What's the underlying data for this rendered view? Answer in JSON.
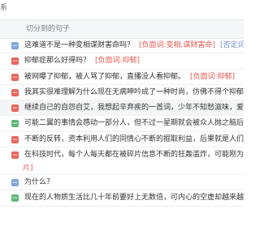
{
  "top_label": "系",
  "header": {
    "title": "切分到的句子"
  },
  "rows": [
    {
      "badge_color": "#7aa6e0",
      "badge_text": "—",
      "text": "这难道不是一种变相谋财害命吗？",
      "tags": [
        "[负面词:变相,谋财害命]",
        "[否定词"
      ]
    },
    {
      "badge_color": "#e8665c",
      "badge_text": "—",
      "text": "抑郁症那么好得吗？",
      "tags": [
        "[负面词:抑郁]"
      ]
    },
    {
      "badge_color": "#e8665c",
      "badge_text": "—",
      "text": "被网曝了抑郁，被人骂了抑郁，直播没人看抑郁。",
      "tags": [
        "[负面词:抑郁]"
      ]
    },
    {
      "badge_color": "#e8665c",
      "badge_text": "—",
      "text": "我其实很难理解为什么现在无病呻吟成了一种时尚，仿佛不得个抑郁症",
      "tags": []
    },
    {
      "badge_color": "#e8665c",
      "badge_text": "—",
      "text": "继续自己的自怨自艾，我想起辛弃疾的一首词，少年不知愁滋味，爱上",
      "tags": []
    },
    {
      "badge_color": "#5fb878",
      "badge_text": "—",
      "text": "可能二翼的事情会感动一部分人，但不过一星期就会被众人抛之脑后。",
      "tags": []
    },
    {
      "badge_color": "#e8665c",
      "badge_text": "—",
      "text": "不断的反转，资本利用人们的同情心不断的掘取利益，后果就是人们心",
      "tags": []
    },
    {
      "badge_color": "#e8665c",
      "badge_text": "—",
      "text": "在科技时代，每个人每天都在被碎片信息不断的狂轰滥炸，可能刚为一",
      "tags": [],
      "second_line": "片]"
    },
    {
      "badge_color": "#7aa6e0",
      "badge_text": "—",
      "text": "为什么？",
      "tags": []
    },
    {
      "badge_color": "#5fb878",
      "badge_text": "—",
      "text": "现在的人物质生活比几十年前要好上无数倍，可内心的空虚却越来越",
      "tags": []
    }
  ]
}
